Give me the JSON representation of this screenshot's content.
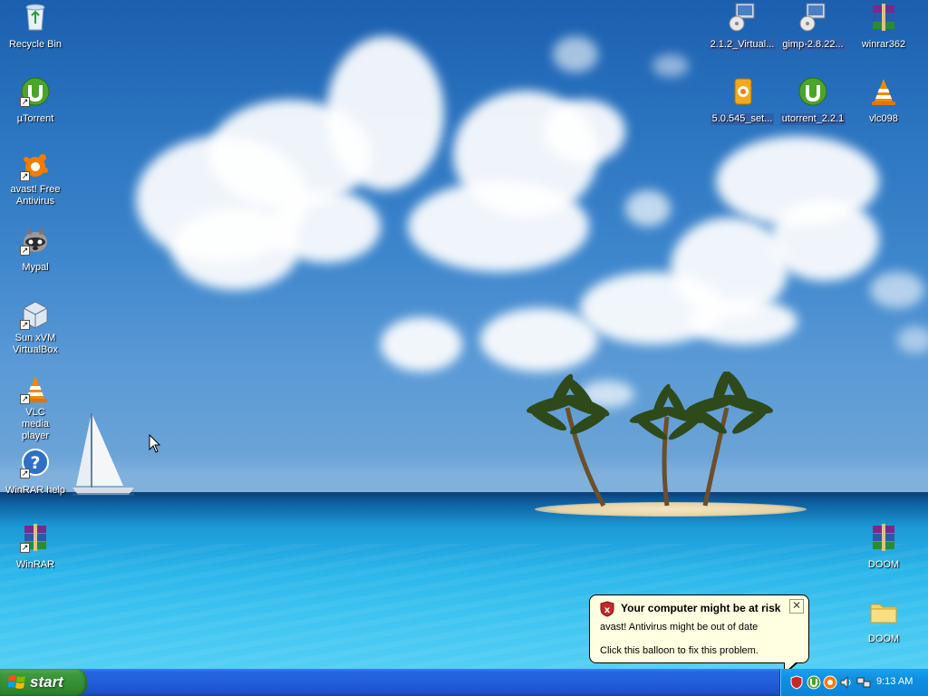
{
  "desktop": {
    "left_icons": [
      {
        "label": "Recycle Bin",
        "icon": "recycle-bin-icon"
      },
      {
        "label": "µTorrent",
        "icon": "utorrent-icon"
      },
      {
        "label": "avast! Free Antivirus",
        "icon": "avast-icon"
      },
      {
        "label": "Mypal",
        "icon": "mypal-raccoon-icon"
      },
      {
        "label": "Sun xVM VirtualBox",
        "icon": "virtualbox-icon"
      },
      {
        "label": "VLC media player",
        "icon": "vlc-cone-icon"
      },
      {
        "label": "WinRAR help",
        "icon": "help-question-icon"
      },
      {
        "label": "WinRAR",
        "icon": "winrar-books-icon"
      }
    ],
    "right_icons": [
      {
        "label": "2.1.2_Virtual...",
        "icon": "installer-icon",
        "selected": true
      },
      {
        "label": "gimp-2.8.22...",
        "icon": "installer-icon",
        "selected": true
      },
      {
        "label": "winrar362",
        "icon": "winrar-books-icon",
        "selected": false
      },
      {
        "label": "5.0.545_set...",
        "icon": "avast-setup-icon",
        "selected": true
      },
      {
        "label": "utorrent_2.2.1",
        "icon": "utorrent-icon",
        "selected": true
      },
      {
        "label": "vlc098",
        "icon": "vlc-cone-icon",
        "selected": false
      },
      {
        "label": "DOOM",
        "icon": "winrar-books-icon",
        "selected": false
      },
      {
        "label": "DOOM",
        "icon": "folder-icon",
        "selected": false
      }
    ]
  },
  "balloon": {
    "title": "Your computer might be at risk",
    "line1": "avast! Antivirus might be out of date",
    "line2": "Click this balloon to fix this problem.",
    "close_glyph": "✕"
  },
  "taskbar": {
    "start_label": "start",
    "clock": "9:13 AM",
    "tray_icons": [
      "security-shield-icon",
      "utorrent-icon",
      "avast-icon",
      "volume-icon",
      "network-icon"
    ]
  },
  "colors": {
    "taskbar_blue": "#245edb",
    "start_green": "#3c9a3c",
    "tray_blue": "#0f8ee0",
    "balloon_bg": "#ffffe1"
  }
}
